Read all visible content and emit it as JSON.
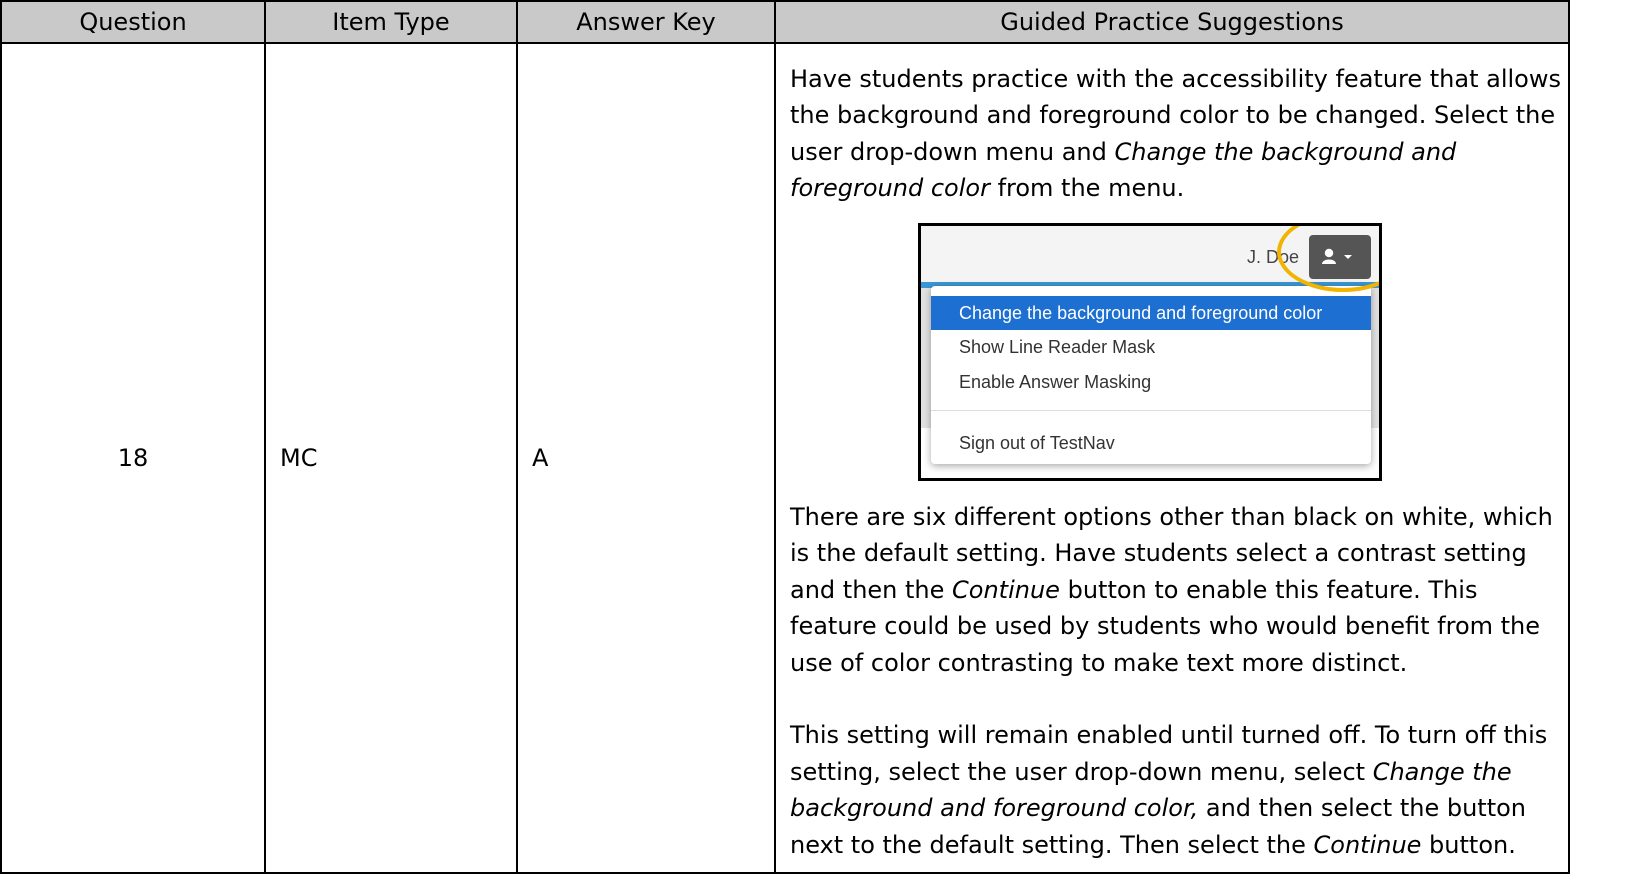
{
  "table": {
    "headers": [
      "Question",
      "Item Type",
      "Answer Key",
      "Guided Practice Suggestions"
    ],
    "row": {
      "question": "18",
      "item_type": "MC",
      "answer_key": "A"
    }
  },
  "guided": {
    "p1_a": "Have students practice with the accessibility feature that allows the background and foreground color to be changed.  Select the user drop-down menu and ",
    "p1_em": "Change the background and foreground color",
    "p1_b": " from the menu.",
    "p2": "There are six different options other than black on white, which is the default setting. Have students select a contrast setting and then the ",
    "p2_em": "Continue",
    "p2_b": " button to enable this feature. This feature could be used by students who would benefit from the use of color contrasting to make text more distinct.",
    "p3_a": "This setting will remain enabled until turned off. To turn off this setting, select the user drop-down menu, select ",
    "p3_em": "Change the background and foreground color,",
    "p3_b": " and then select the button next to the default setting. Then select the ",
    "p3_em2": "Continue",
    "p3_c": " button."
  },
  "screenshot": {
    "user_name": "J. Doe",
    "menu_items": [
      "Change the background and foreground color",
      "Show Line Reader Mask",
      "Enable Answer Masking",
      "Sign out of TestNav"
    ],
    "highlight_color": "#f2b400",
    "active_color": "#1e6fd2",
    "user_icon": "user-icon",
    "caret_icon": "caret-down-icon"
  }
}
